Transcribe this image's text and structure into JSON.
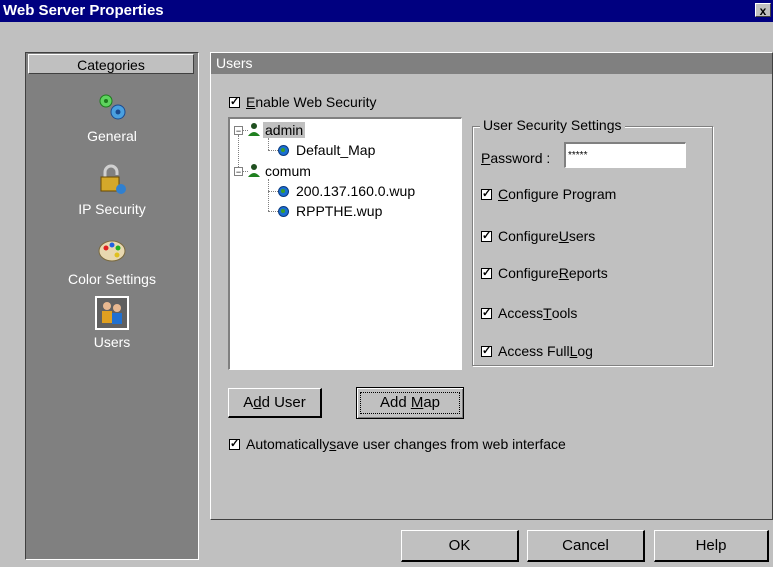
{
  "window": {
    "title": "Web Server Properties",
    "close_label": "x"
  },
  "sidebar": {
    "header": "Categories",
    "items": [
      {
        "label": "General",
        "icon": "gears-icon"
      },
      {
        "label": "IP Security",
        "icon": "padlock-icon"
      },
      {
        "label": "Color Settings",
        "icon": "palette-icon"
      },
      {
        "label": "Users",
        "icon": "users-icon",
        "selected": true
      }
    ]
  },
  "panel": {
    "title": "Users",
    "enable_security": {
      "pre": "",
      "key": "E",
      "post": "nable Web Security",
      "checked": true
    },
    "tree": {
      "nodes": [
        {
          "label": "admin",
          "type": "user",
          "selected": true
        },
        {
          "label": "Default_Map",
          "type": "map"
        },
        {
          "label": "comum",
          "type": "user"
        },
        {
          "label": "200.137.160.0.wup",
          "type": "map"
        },
        {
          "label": "RPPTHE.wup",
          "type": "map"
        }
      ]
    },
    "security_settings": {
      "title": "User Security Settings",
      "password_label": {
        "pre": "",
        "key": "P",
        "post": "assword :"
      },
      "password_value": "*****",
      "options": [
        {
          "pre": "",
          "key": "C",
          "post": "onfigure Program",
          "checked": true
        },
        {
          "pre": "Configure ",
          "key": "U",
          "post": "sers",
          "checked": true
        },
        {
          "pre": "Configure ",
          "key": "R",
          "post": "eports",
          "checked": true
        },
        {
          "pre": "Access ",
          "key": "T",
          "post": "ools",
          "checked": true
        },
        {
          "pre": "Access Full ",
          "key": "L",
          "post": "og",
          "checked": true
        }
      ]
    },
    "add_user": {
      "pre": "A",
      "key": "d",
      "post": "d User"
    },
    "add_map": {
      "pre": "Add ",
      "key": "M",
      "post": "ap"
    },
    "auto_save": {
      "pre": "Automatically ",
      "key": "s",
      "post": "ave user changes from web interface",
      "checked": true
    }
  },
  "footer": {
    "ok": "OK",
    "cancel": "Cancel",
    "help": "Help"
  }
}
